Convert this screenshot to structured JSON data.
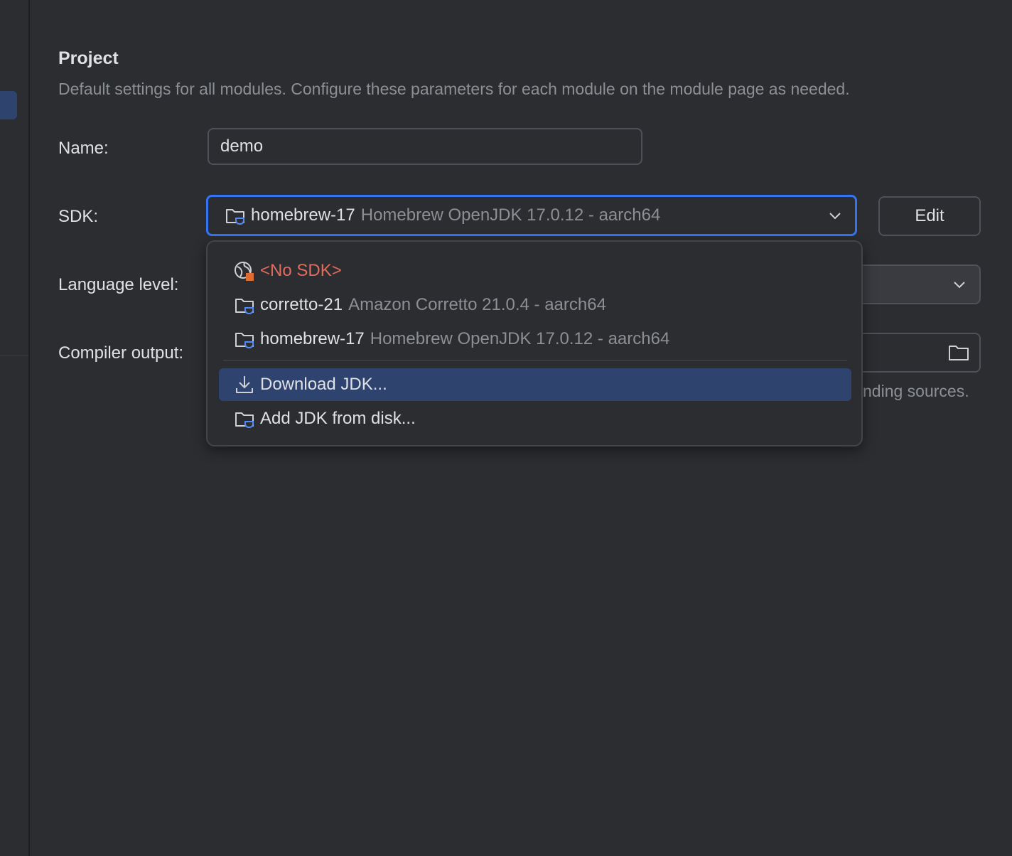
{
  "section": {
    "title": "Project",
    "description": "Default settings for all modules. Configure these parameters for each module on the module page as needed."
  },
  "form": {
    "name_label": "Name:",
    "name_value": "demo",
    "sdk_label": "SDK:",
    "sdk_selected_name": "homebrew-17",
    "sdk_selected_detail": "Homebrew OpenJDK 17.0.12 - aarch64",
    "edit_label": "Edit",
    "language_level_label": "Language level:",
    "compiler_output_label": "Compiler output:",
    "compiler_output_hint_fragment": "nding sources."
  },
  "dropdown": {
    "items": [
      {
        "name": "<No SDK>",
        "detail": "",
        "icon": "no-sdk-icon"
      },
      {
        "name": "corretto-21",
        "detail": "Amazon Corretto 21.0.4 - aarch64",
        "icon": "jdk-folder-icon"
      },
      {
        "name": "homebrew-17",
        "detail": "Homebrew OpenJDK 17.0.12 - aarch64",
        "icon": "jdk-folder-icon"
      }
    ],
    "actions": [
      {
        "label": "Download JDK...",
        "icon": "download-icon",
        "highlighted": true
      },
      {
        "label": "Add JDK from disk...",
        "icon": "jdk-folder-icon",
        "highlighted": false
      }
    ]
  },
  "colors": {
    "background": "#2b2d30",
    "focus_border": "#3574f0",
    "selection": "#2e436e",
    "error_text": "#e06c5f",
    "muted_text": "#8c8f94"
  }
}
